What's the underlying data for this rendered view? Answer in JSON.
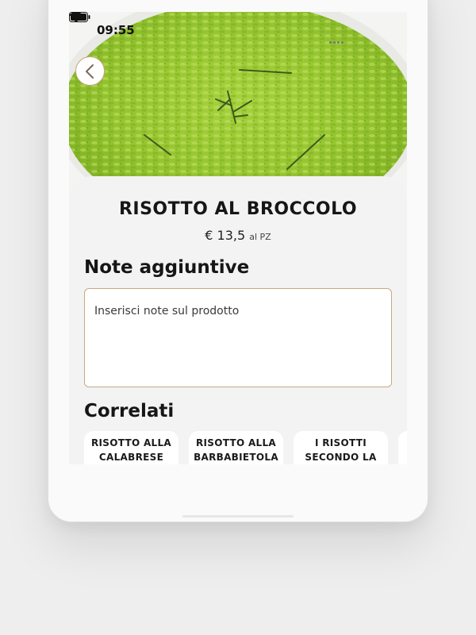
{
  "status_bar": {
    "time": "09:55",
    "icons": [
      "signal-dots-icon",
      "wifi-icon",
      "battery-icon"
    ]
  },
  "hero": {
    "image": "risotto-photo",
    "back_icon": "chevron-left-icon"
  },
  "product": {
    "title": "RISOTTO AL BROCCOLO",
    "price": "€ 13,5",
    "price_unit": "al PZ"
  },
  "notes": {
    "title": "Note aggiuntive",
    "placeholder": "Inserisci note sul prodotto",
    "value": ""
  },
  "related": {
    "title": "Correlati",
    "items": [
      {
        "label": "RISOTTO ALLA CALABRESE"
      },
      {
        "label": "RISOTTO ALLA BARBABIETOLA"
      },
      {
        "label": "I RISOTTI SECONDO LA"
      }
    ]
  },
  "colors": {
    "accent_border": "#c9a784",
    "sheet_background": "#f3f3f3",
    "card_background": "#ffffff",
    "text_primary": "#161616"
  }
}
